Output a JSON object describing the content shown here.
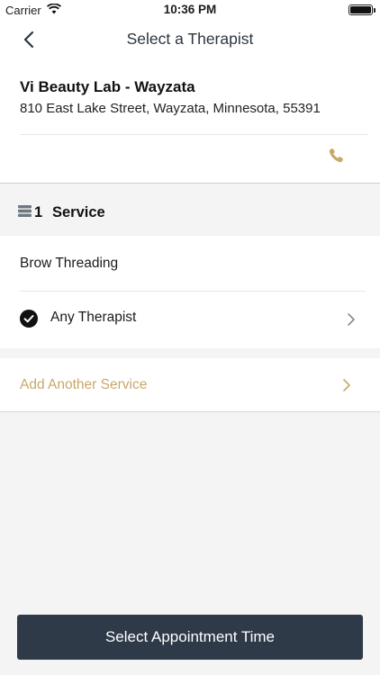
{
  "status_bar": {
    "carrier": "Carrier",
    "time": "10:36 PM"
  },
  "nav": {
    "title": "Select a Therapist"
  },
  "salon": {
    "name": "Vi Beauty Lab - Wayzata",
    "address": "810 East Lake Street, Wayzata, Minnesota, 55391"
  },
  "services_section": {
    "count": "1",
    "title": "Service"
  },
  "service": {
    "name": "Brow Threading",
    "therapist": "Any Therapist"
  },
  "add_service": {
    "label": "Add Another Service"
  },
  "cta": {
    "label": "Select Appointment Time"
  },
  "colors": {
    "accent_gold": "#c9a86a",
    "cta_background": "#2e3a47",
    "page_background": "#f4f4f4"
  }
}
